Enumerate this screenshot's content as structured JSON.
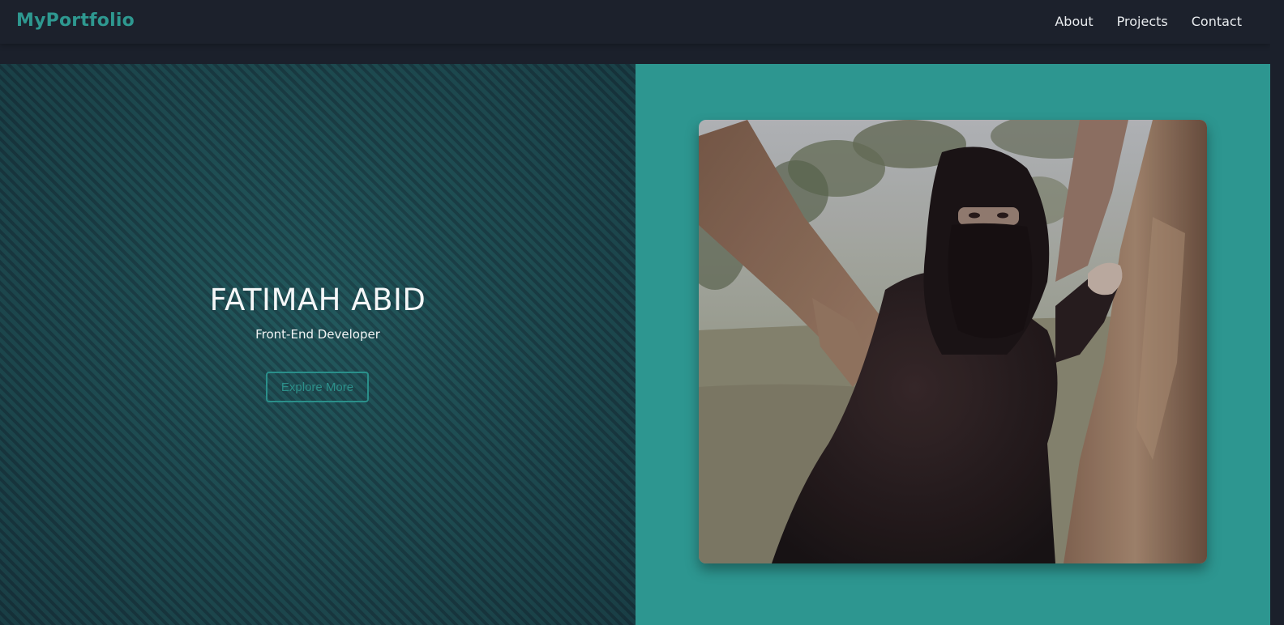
{
  "navbar": {
    "brand": "MyPortfolio",
    "links": [
      {
        "label": "About"
      },
      {
        "label": "Projects"
      },
      {
        "label": "Contact"
      }
    ]
  },
  "hero": {
    "name": "FATIMAH ABID",
    "role": "Front-End Developer",
    "cta_label": "Explore More",
    "photo": {
      "subject": "woman in black abaya and niqab leaning against tree trunks"
    }
  },
  "colors": {
    "accent": "#2e9890",
    "navbar_bg": "#1b202b",
    "hero_right_bg": "#2d9690",
    "text_light": "#f5f7f8"
  }
}
